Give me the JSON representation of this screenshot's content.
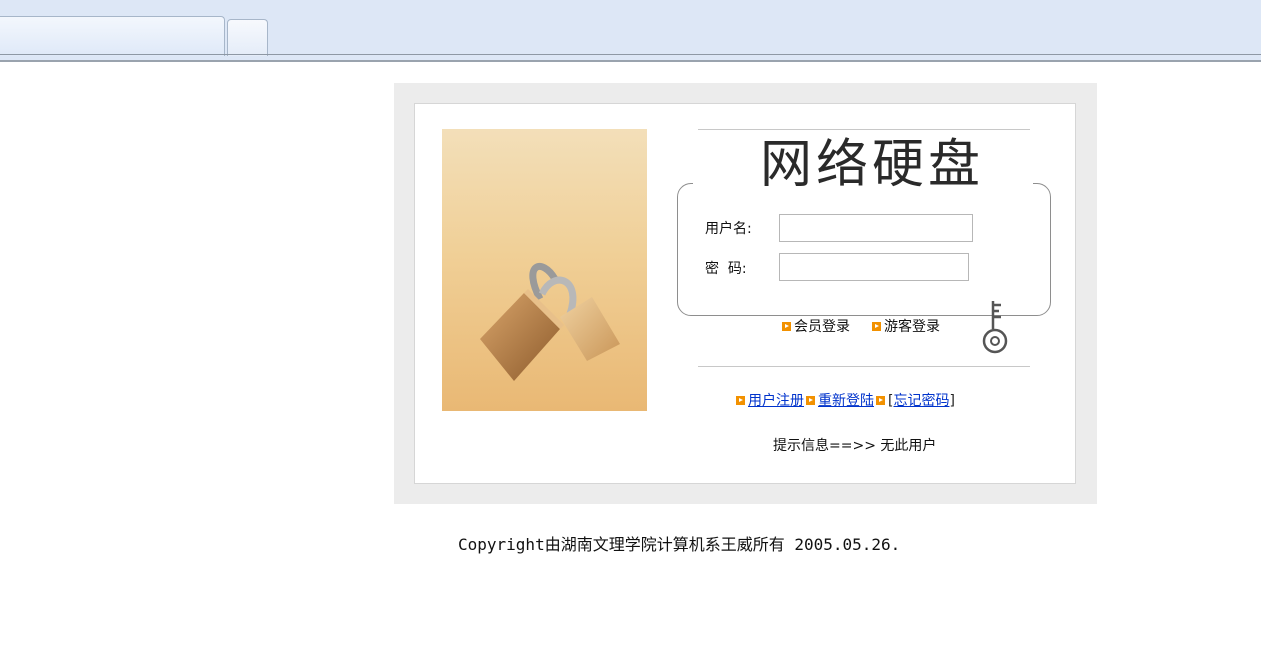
{
  "login": {
    "title": "网络硬盘",
    "username_label": "用户名:",
    "username_value": "",
    "password_label": "密  码:",
    "password_value": "",
    "member_login": "会员登录",
    "guest_login": "游客登录",
    "links": {
      "register": "用户注册",
      "relogin": "重新登陆",
      "forgot_open": "[",
      "forgot": "忘记密码",
      "forgot_close": "]"
    },
    "hint": "提示信息==>> 无此用户"
  },
  "footer": {
    "copyright": "Copyright由湖南文理学院计算机系王威所有 2005.05.26."
  },
  "colors": {
    "bullet": "#f29100",
    "link": "#0033cc",
    "panel_border": "#ececec"
  },
  "icons": [
    "padlock-image",
    "key-icon",
    "arrow-bullet-icon"
  ]
}
